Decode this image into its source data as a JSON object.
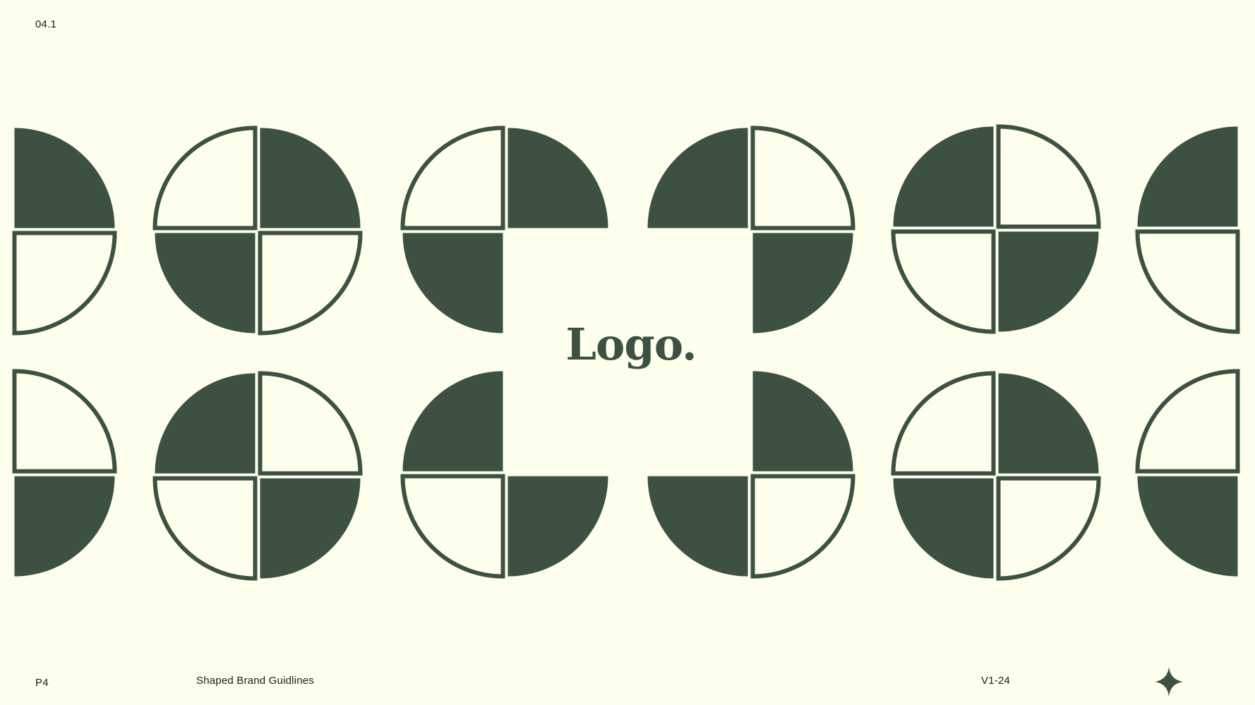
{
  "header": {
    "section_number": "04.1"
  },
  "logo": {
    "wordmark": "Logo."
  },
  "footer": {
    "page_number": "P4",
    "document_title": "Shaped Brand Guidlines",
    "version": "V1-24"
  },
  "colors": {
    "background": "#fefeec",
    "shape_fill": "#3d5143",
    "text": "#1c1c1c"
  },
  "icons": {
    "footer_mark": "four-point-sparkle-icon"
  }
}
